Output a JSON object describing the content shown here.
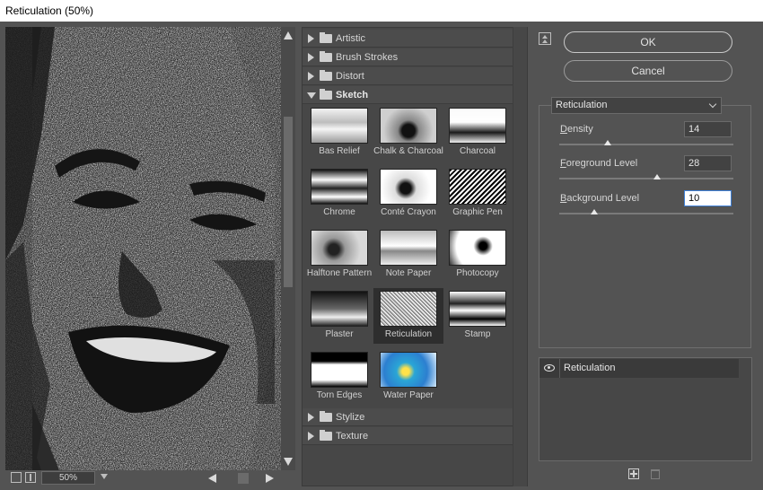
{
  "window": {
    "title": "Reticulation (50%)"
  },
  "preview": {
    "zoom": "50%"
  },
  "gallery": {
    "categories_top": [
      {
        "label": "Artistic",
        "expanded": false
      },
      {
        "label": "Brush Strokes",
        "expanded": false
      },
      {
        "label": "Distort",
        "expanded": false
      },
      {
        "label": "Sketch",
        "expanded": true
      }
    ],
    "sketch_filters": [
      "Bas Relief",
      "Chalk & Charcoal",
      "Charcoal",
      "Chrome",
      "Conté Crayon",
      "Graphic Pen",
      "Halftone Pattern",
      "Note Paper",
      "Photocopy",
      "Plaster",
      "Reticulation",
      "Stamp",
      "Torn Edges",
      "Water Paper"
    ],
    "selected_filter": "Reticulation",
    "categories_bottom": [
      {
        "label": "Stylize",
        "expanded": false
      },
      {
        "label": "Texture",
        "expanded": false
      }
    ]
  },
  "buttons": {
    "ok": "OK",
    "cancel": "Cancel"
  },
  "settings": {
    "filter": "Reticulation",
    "params": [
      {
        "label": "Density",
        "accel": "D",
        "rest": "ensity",
        "value": "14",
        "min": 0,
        "max": 50,
        "num": 14
      },
      {
        "label": "Foreground Level",
        "accel": "F",
        "rest": "oreground Level",
        "value": "28",
        "min": 0,
        "max": 50,
        "num": 28
      },
      {
        "label": "Background Level",
        "accel": "B",
        "rest": "ackground Level",
        "value": "10",
        "min": 0,
        "max": 50,
        "num": 10
      }
    ]
  },
  "layers": [
    {
      "name": "Reticulation",
      "visible": true
    }
  ]
}
